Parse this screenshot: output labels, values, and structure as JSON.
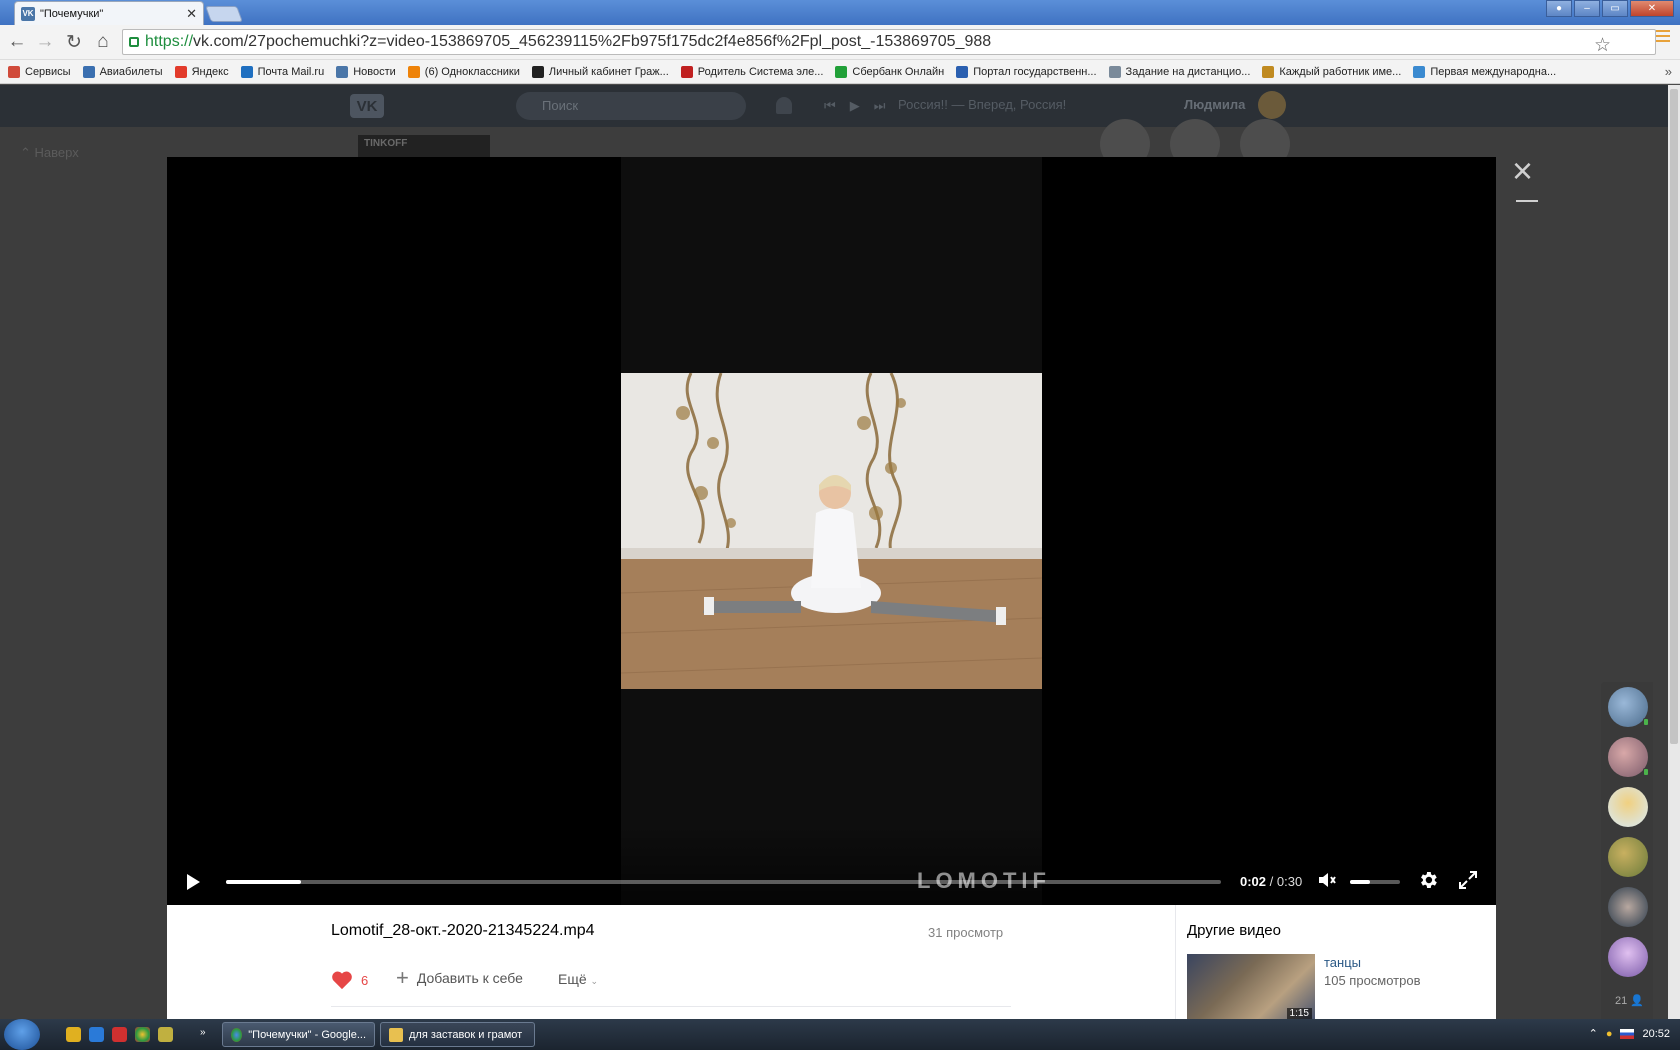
{
  "browser": {
    "tab_title": "\"Почемучки\"",
    "url_scheme": "https://",
    "url_rest": "vk.com/27pochemuchki?z=video-153869705_456239115%2Fb975f175dc2f4e856f%2Fpl_post_-153869705_988",
    "bookmarks": [
      {
        "label": "Сервисы",
        "icon_color": "#d04a3a"
      },
      {
        "label": "Авиабилеты",
        "icon_color": "#3a6fb0"
      },
      {
        "label": "Яндекс",
        "icon_color": "#e23a2a"
      },
      {
        "label": "Почта Mail.ru",
        "icon_color": "#1f6fc0"
      },
      {
        "label": "Новости",
        "icon_color": "#4a76a8"
      },
      {
        "label": "(6) Одноклассники",
        "icon_color": "#ee8208"
      },
      {
        "label": "Личный кабинет Граж...",
        "icon_color": "#222222"
      },
      {
        "label": "Родитель Система эле...",
        "icon_color": "#c02020"
      },
      {
        "label": "Сбербанк Онлайн",
        "icon_color": "#21a038"
      },
      {
        "label": "Портал государственн...",
        "icon_color": "#2a5fb0"
      },
      {
        "label": "Задание на дистанцио...",
        "icon_color": "#7a8a9a"
      },
      {
        "label": "Каждый работник име...",
        "icon_color": "#c08a20"
      },
      {
        "label": "Первая международна...",
        "icon_color": "#3a8ad0"
      }
    ]
  },
  "vk": {
    "search_placeholder": "Поиск",
    "now_playing": "Россия!! — Вперед, Россия!",
    "user_name": "Людмила",
    "up_link": "Наверх",
    "ad_label": "TINKOFF",
    "logo_text": "VK"
  },
  "video": {
    "time_current": "0:02",
    "time_total": "0:30",
    "progress_fraction": 0.075,
    "volume_fraction": 0.4,
    "watermark": "LOMOTIF",
    "title": "Lomotif_28-окт.-2020-21345224.mp4",
    "views": "31 просмотр",
    "likes": "6",
    "add_label": "Добавить к себе",
    "more_label": "Ещё",
    "other_videos_title": "Другие видео",
    "related": {
      "name": "танцы",
      "views": "105 просмотров",
      "duration": "1:15"
    }
  },
  "chat": {
    "count": "21"
  },
  "taskbar": {
    "items": [
      {
        "label": "\"Почемучки\" - Google..."
      },
      {
        "label": "для заставок и грамот"
      }
    ],
    "clock": "20:52"
  },
  "colors": {
    "vk_blue": "#4a76a8",
    "like_red": "#e64646",
    "link_blue": "#2a5885"
  }
}
